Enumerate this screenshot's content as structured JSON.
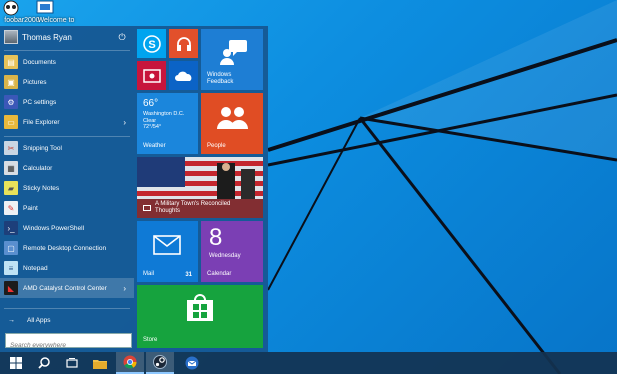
{
  "desktop": {
    "icons": [
      {
        "label": "foobar2000",
        "icon": "foobar-icon"
      },
      {
        "label": "Welcome to",
        "icon": "welcome-icon"
      }
    ]
  },
  "start_menu": {
    "user_name": "Thomas Ryan",
    "power_icon": "power-icon",
    "places": [
      {
        "label": "Documents",
        "icon": "documents-icon"
      },
      {
        "label": "Pictures",
        "icon": "pictures-icon"
      },
      {
        "label": "PC settings",
        "icon": "gear-icon"
      },
      {
        "label": "File Explorer",
        "icon": "folder-icon",
        "arrow": "›"
      }
    ],
    "apps": [
      {
        "label": "Snipping Tool",
        "icon": "scissors-icon"
      },
      {
        "label": "Calculator",
        "icon": "calculator-icon"
      },
      {
        "label": "Sticky Notes",
        "icon": "sticky-notes-icon"
      },
      {
        "label": "Paint",
        "icon": "paint-icon"
      },
      {
        "label": "Windows PowerShell",
        "icon": "powershell-icon"
      },
      {
        "label": "Remote Desktop Connection",
        "icon": "remote-desktop-icon"
      },
      {
        "label": "Notepad",
        "icon": "notepad-icon"
      },
      {
        "label": "AMD Catalyst Control Center",
        "icon": "amd-icon",
        "arrow": "›"
      }
    ],
    "all_apps_label": "All Apps",
    "search_placeholder": "Search everywhere"
  },
  "tiles": {
    "feedback": {
      "label_line1": "Windows",
      "label_line2": "Feedback"
    },
    "weather": {
      "temp": "66°",
      "city": "Washington D.C.",
      "condition": "Clear",
      "range": "72°/54°",
      "label": "Weather"
    },
    "people": {
      "label": "People"
    },
    "news": {
      "headline_line1": "A Military Town's Reconciled",
      "headline_line2": "Thoughts"
    },
    "mail": {
      "label": "Mail",
      "count": "31"
    },
    "calendar": {
      "day": "8",
      "weekday": "Wednesday",
      "label": "Calendar"
    },
    "store": {
      "label": "Store"
    }
  },
  "colors": {
    "skype": "#00a4ef",
    "music": "#e2502b",
    "video": "#c7153c",
    "onedrive": "#0b63c6",
    "feedback": "#1e7ed4",
    "weather": "#1b86dc",
    "people": "#e04d24",
    "mail": "#0f7ad6",
    "calendar": "#7b3fb4",
    "store": "#16a33e"
  },
  "taskbar": {
    "items": [
      {
        "name": "start-button",
        "icon": "windows-logo-icon"
      },
      {
        "name": "search-button",
        "icon": "search-icon"
      },
      {
        "name": "task-view-button",
        "icon": "task-view-icon"
      },
      {
        "name": "file-explorer-button",
        "icon": "folder-icon"
      },
      {
        "name": "chrome-button",
        "icon": "chrome-icon"
      },
      {
        "name": "steam-button",
        "icon": "steam-icon"
      },
      {
        "name": "thunderbird-button",
        "icon": "thunderbird-icon"
      }
    ]
  }
}
